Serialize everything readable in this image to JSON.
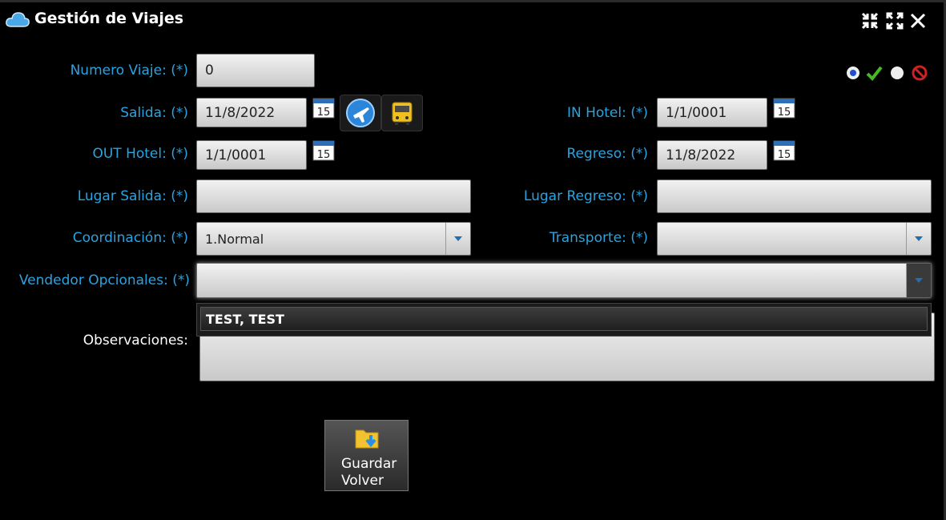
{
  "window": {
    "title": "Gestión de Viajes"
  },
  "icons": {
    "app": "cloud-icon",
    "minimize": "compress-icon",
    "maximize": "expand-icon",
    "close": "close-icon",
    "calendar_day": "15",
    "status": [
      "radio-icon",
      "check-icon",
      "radio-icon",
      "forbidden-icon"
    ]
  },
  "colors": {
    "label": "#2aa3e0",
    "background": "#000000",
    "check": "#44bb22",
    "forbidden": "#cc2222"
  },
  "form": {
    "numero_viaje": {
      "label": "Numero Viaje: (*)",
      "value": "0"
    },
    "salida": {
      "label": "Salida: (*)",
      "value": "11/8/2022"
    },
    "in_hotel": {
      "label": "IN Hotel: (*)",
      "value": "1/1/0001"
    },
    "out_hotel": {
      "label": "OUT Hotel: (*)",
      "value": "1/1/0001"
    },
    "regreso": {
      "label": "Regreso: (*)",
      "value": "11/8/2022"
    },
    "lugar_salida": {
      "label": "Lugar Salida: (*)",
      "value": ""
    },
    "lugar_regreso": {
      "label": "Lugar Regreso: (*)",
      "value": ""
    },
    "coordinacion": {
      "label": "Coordinación: (*)",
      "value": "1.Normal"
    },
    "transporte": {
      "label": "Transporte: (*)",
      "value": ""
    },
    "vendedor": {
      "label": "Vendedor Opcionales: (*)",
      "value": "",
      "options": [
        "TEST, TEST"
      ]
    },
    "observaciones": {
      "label": "Observaciones:",
      "value": ""
    }
  },
  "buttons": {
    "save_line1": "Guardar",
    "save_line2": "Volver"
  }
}
